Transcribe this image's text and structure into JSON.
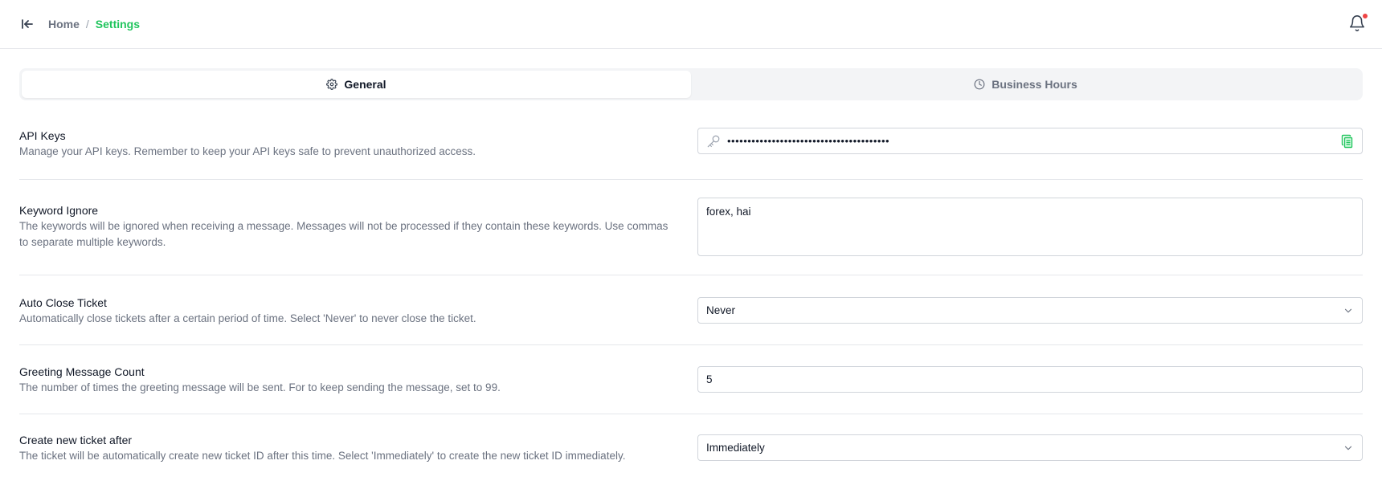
{
  "breadcrumb": {
    "home": "Home",
    "separator": "/",
    "current": "Settings"
  },
  "tabs": [
    {
      "label": "General",
      "icon": "gear-icon",
      "active": true
    },
    {
      "label": "Business Hours",
      "icon": "clock-icon",
      "active": false
    }
  ],
  "settings": {
    "api_keys": {
      "title": "API Keys",
      "description": "Manage your API keys. Remember to keep your API keys safe to prevent unauthorized access.",
      "value": "••••••••••••••••••••••••••••••••••••••••"
    },
    "keyword_ignore": {
      "title": "Keyword Ignore",
      "description": "The keywords will be ignored when receiving a message. Messages will not be processed if they contain these keywords. Use commas to separate multiple keywords.",
      "value": "forex, hai"
    },
    "auto_close": {
      "title": "Auto Close Ticket",
      "description": "Automatically close tickets after a certain period of time. Select 'Never' to never close the ticket.",
      "value": "Never"
    },
    "greeting_count": {
      "title": "Greeting Message Count",
      "description": "The number of times the greeting message will be sent. For to keep sending the message, set to 99.",
      "value": "5"
    },
    "new_ticket": {
      "title": "Create new ticket after",
      "description": "The ticket will be automatically create new ticket ID after this time. Select 'Immediately' to create the new ticket ID immediately.",
      "value": "Immediately"
    }
  },
  "colors": {
    "accent": "#22c55e",
    "notification": "#ef4444",
    "copy_icon": "#22c55e"
  }
}
